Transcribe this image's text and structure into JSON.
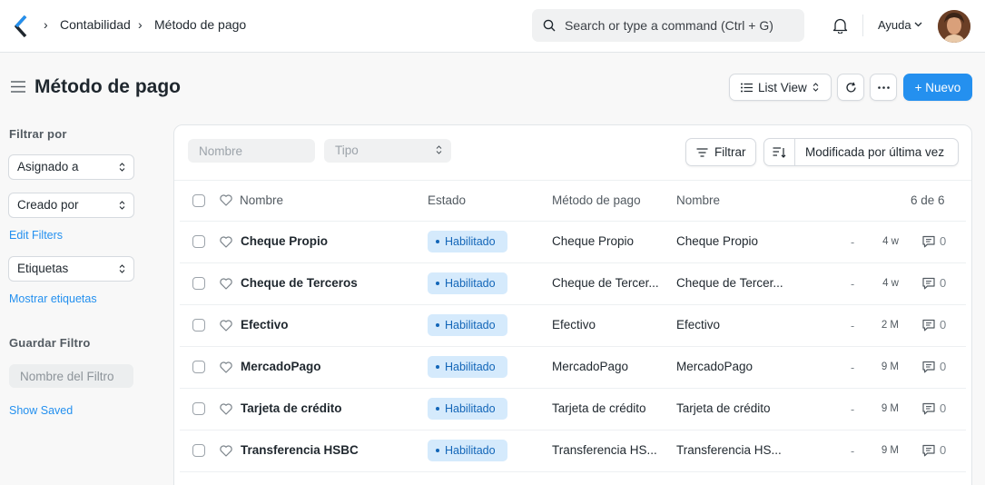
{
  "navbar": {
    "breadcrumbs": [
      "Contabilidad",
      "Método de pago"
    ],
    "search_placeholder": "Search or type a command (Ctrl + G)",
    "help_label": "Ayuda"
  },
  "page": {
    "title": "Método de pago",
    "list_view_label": "List View",
    "new_button_label": "+ Nuevo"
  },
  "sidebar": {
    "filter_by_label": "Filtrar por",
    "assigned_to_label": "Asignado a",
    "created_by_label": "Creado por",
    "edit_filters_label": "Edit Filters",
    "tags_label": "Etiquetas",
    "show_tags_label": "Mostrar etiquetas",
    "save_filter_label": "Guardar Filtro",
    "filter_name_placeholder": "Nombre del Filtro",
    "show_saved_label": "Show Saved"
  },
  "filters": {
    "name_placeholder": "Nombre",
    "type_placeholder": "Tipo",
    "filter_button_label": "Filtrar",
    "sort_label": "Modificada por última vez"
  },
  "table": {
    "headers": {
      "name": "Nombre",
      "status": "Estado",
      "payment_method": "Método de pago",
      "name2": "Nombre",
      "count": "6 de 6"
    },
    "rows": [
      {
        "name": "Cheque Propio",
        "status": "Habilitado",
        "method": "Cheque Propio",
        "name2": "Cheque Propio",
        "dash": "-",
        "ago": "4 w",
        "comments": "0"
      },
      {
        "name": "Cheque de Terceros",
        "status": "Habilitado",
        "method": "Cheque de Tercer...",
        "name2": "Cheque de Tercer...",
        "dash": "-",
        "ago": "4 w",
        "comments": "0"
      },
      {
        "name": "Efectivo",
        "status": "Habilitado",
        "method": "Efectivo",
        "name2": "Efectivo",
        "dash": "-",
        "ago": "2 M",
        "comments": "0"
      },
      {
        "name": "MercadoPago",
        "status": "Habilitado",
        "method": "MercadoPago",
        "name2": "MercadoPago",
        "dash": "-",
        "ago": "9 M",
        "comments": "0"
      },
      {
        "name": "Tarjeta de crédito",
        "status": "Habilitado",
        "method": "Tarjeta de crédito",
        "name2": "Tarjeta de crédito",
        "dash": "-",
        "ago": "9 M",
        "comments": "0"
      },
      {
        "name": "Transferencia HSBC",
        "status": "Habilitado",
        "method": "Transferencia HS...",
        "name2": "Transferencia HS...",
        "dash": "-",
        "ago": "9 M",
        "comments": "0"
      }
    ]
  },
  "colors": {
    "accent": "#2490ef",
    "badge_bg": "#d5eafc",
    "badge_text": "#1366b8"
  }
}
